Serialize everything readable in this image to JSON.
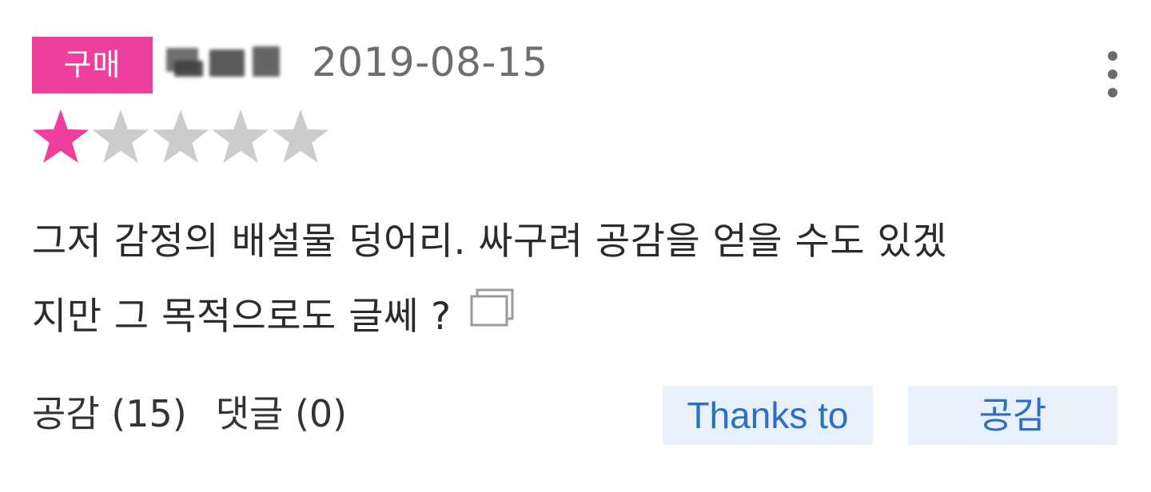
{
  "review": {
    "badge_label": "구매",
    "date": "2019-08-15",
    "rating": {
      "value": 1,
      "max": 5,
      "filled_color": "#ee3f9c",
      "empty_color": "#cccccc"
    },
    "text_line1": "그저 감정의 배설물 덩어리. 싸구려 공감을 얻을 수도 있겠",
    "text_line2": "지만 그 목적으로도 글쎄 ?",
    "likes_label": "공감 (15)",
    "comments_label": "댓글 (0)",
    "thanks_button_label": "Thanks to",
    "like_button_label": "공감"
  },
  "icons": {
    "more": "more-vertical-icon",
    "copy": "copy-icon",
    "star": "star-icon"
  },
  "colors": {
    "accent": "#ee3f9c",
    "button_bg": "#e8f0fb",
    "button_text": "#2c6fc4",
    "date_text": "#6e6e6e"
  }
}
